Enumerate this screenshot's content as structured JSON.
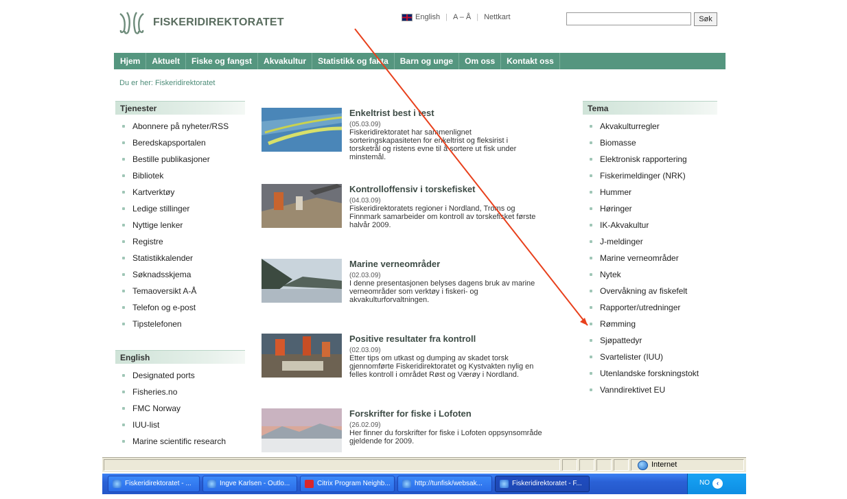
{
  "header": {
    "logo_text": "FISKERIDIREKTORATET",
    "english_link": "English",
    "az_link": "A – Å",
    "sitemap_link": "Nettkart",
    "search_value": "",
    "search_button": "Søk"
  },
  "nav": {
    "items": [
      "Hjem",
      "Aktuelt",
      "Fiske og fangst",
      "Akvakultur",
      "Statistikk og fakta",
      "Barn og unge",
      "Om oss",
      "Kontakt oss"
    ]
  },
  "breadcrumb": "Du er her: Fiskeridirektoratet",
  "services": {
    "title": "Tjenester",
    "items": [
      "Abonnere på nyheter/RSS",
      "Beredskapsportalen",
      "Bestille publikasjoner",
      "Bibliotek",
      "Kartverktøy",
      "Ledige stillinger",
      "Nyttige lenker",
      "Registre",
      "Statistikkalender",
      "Søknadsskjema",
      "Temaoversikt A-Å",
      "Telefon og e-post",
      "Tipstelefonen"
    ]
  },
  "english": {
    "title": "English",
    "items": [
      "Designated ports",
      "Fisheries.no",
      "FMC Norway",
      "IUU-list",
      "Marine scientific research"
    ]
  },
  "tema": {
    "title": "Tema",
    "items": [
      "Akvakulturregler",
      "Biomasse",
      "Elektronisk rapportering",
      "Fiskerimeldinger (NRK)",
      "Hummer",
      "Høringer",
      "IK-Akvakultur",
      "J-meldinger",
      "Marine verneområder",
      "Nytek",
      "Overvåkning av fiskefelt",
      "Rapporter/utredninger",
      "Rømming",
      "Sjøpattedyr",
      "Svartelister (IUU)",
      "Utenlandske forskningstokt",
      "Vanndirektivet EU"
    ]
  },
  "news": [
    {
      "title": "Enkeltrist best i test",
      "date": "(05.03.09)",
      "body": [
        "Fiskeridirektoratet har sammenlignet",
        "sorteringskapasiteten for enkeltrist og fleksirist i",
        "torsketrål og ristens evne til å sortere ut fisk under",
        "minstemål."
      ]
    },
    {
      "title": "Kontrolloffensiv i torskefisket",
      "date": "(04.03.09)",
      "body": [
        "Fiskeridirektoratets regioner i Nordland, Troms og",
        "Finnmark samarbeider om kontroll av torskefisket første",
        "halvår 2009."
      ]
    },
    {
      "title": "Marine verneområder",
      "date": "(02.03.09)",
      "body": [
        "I denne presentasjonen belyses dagens bruk av marine",
        "verneområder som verktøy i fiskeri- og",
        "akvakulturforvaltningen."
      ]
    },
    {
      "title": "Positive resultater fra kontroll",
      "date": "(02.03.09)",
      "body": [
        "Etter tips om utkast og dumping av skadet torsk",
        "gjennomførte Fiskeridirektoratet og Kystvakten nylig en",
        "felles kontroll i området Røst og Værøy i Nordland."
      ]
    },
    {
      "title": "Forskrifter for fiske i Lofoten",
      "date": "(26.02.09)",
      "body": [
        "Her finner du forskrifter for fiske i Lofoten oppsynsområde",
        "gjeldende for 2009."
      ]
    }
  ],
  "statusbar": {
    "zone": "Internet"
  },
  "taskbar": {
    "buttons": [
      "Fiskeridirektoratet - ...",
      "Ingve Karlsen - Outlo...",
      "Citrix Program Neighb...",
      "http://tunfisk/websak...",
      "Fiskeridirektoratet - F..."
    ],
    "lang": "NO"
  },
  "colors": {
    "nav_bg": "#55967f",
    "annotation_arrow": "#e8401c"
  }
}
